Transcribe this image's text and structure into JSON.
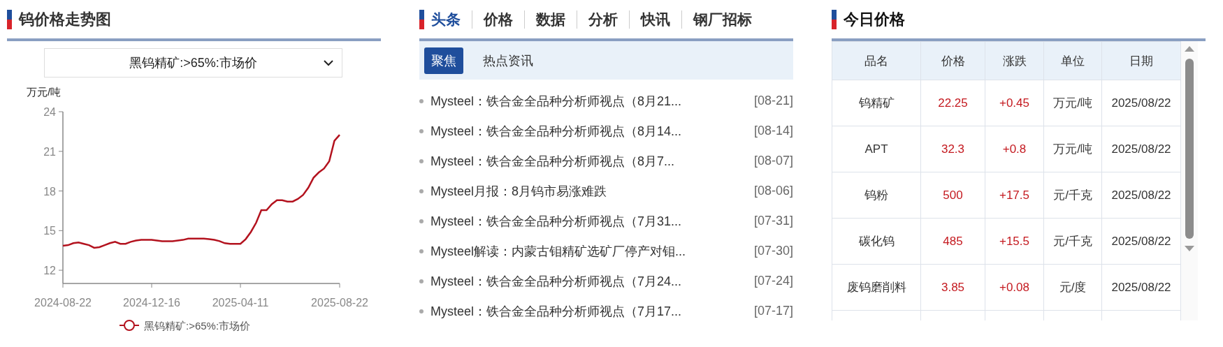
{
  "chart_panel": {
    "title": "钨价格走势图",
    "select": {
      "value": "黑钨精矿:>65%:市场价"
    },
    "chart_data": {
      "type": "line",
      "ylabel": "万元/吨",
      "categories": [
        "2024-08-22",
        null,
        null,
        null,
        null,
        null,
        null,
        null,
        null,
        null,
        null,
        null,
        null,
        null,
        null,
        null,
        null,
        "2024-12-16",
        null,
        null,
        null,
        null,
        null,
        null,
        null,
        null,
        null,
        null,
        null,
        null,
        null,
        null,
        null,
        null,
        "2025-04-11",
        null,
        null,
        null,
        null,
        null,
        null,
        null,
        null,
        null,
        null,
        null,
        null,
        null,
        null,
        null,
        null,
        null,
        null,
        "2025-08-22"
      ],
      "ylim": [
        11,
        24
      ],
      "yticks": [
        12,
        15,
        18,
        21,
        24
      ],
      "series": [
        {
          "name": "黑钨精矿:>65%:市场价",
          "color": "#b3121e",
          "values": [
            13.85,
            13.9,
            14.05,
            14.1,
            14.0,
            13.9,
            13.7,
            13.75,
            13.9,
            14.05,
            14.15,
            14.0,
            14.0,
            14.15,
            14.25,
            14.3,
            14.3,
            14.3,
            14.25,
            14.2,
            14.2,
            14.2,
            14.25,
            14.3,
            14.4,
            14.4,
            14.4,
            14.4,
            14.35,
            14.3,
            14.2,
            14.05,
            14.0,
            14.0,
            14.0,
            14.35,
            14.9,
            15.6,
            16.55,
            16.55,
            17.0,
            17.3,
            17.3,
            17.2,
            17.2,
            17.4,
            17.7,
            18.25,
            19.0,
            19.4,
            19.7,
            20.25,
            21.8,
            22.25
          ]
        }
      ]
    }
  },
  "news_panel": {
    "tabs": [
      {
        "label": "头条",
        "selected": true
      },
      {
        "label": "价格",
        "selected": false
      },
      {
        "label": "数据",
        "selected": false
      },
      {
        "label": "分析",
        "selected": false
      },
      {
        "label": "快讯",
        "selected": false
      },
      {
        "label": "钢厂招标",
        "selected": false
      }
    ],
    "subtabs": [
      {
        "label": "聚焦",
        "selected": true
      },
      {
        "label": "热点资讯",
        "selected": false
      }
    ],
    "items": [
      {
        "title": "Mysteel：铁合金全品种分析师视点（8月21...",
        "date": "[08-21]"
      },
      {
        "title": "Mysteel：铁合金全品种分析师视点（8月14...",
        "date": "[08-14]"
      },
      {
        "title": "Mysteel：铁合金全品种分析师视点（8月7...",
        "date": "[08-07]"
      },
      {
        "title": "Mysteel月报：8月钨市易涨难跌",
        "date": "[08-06]"
      },
      {
        "title": "Mysteel：铁合金全品种分析师视点（7月31...",
        "date": "[07-31]"
      },
      {
        "title": "Mysteel解读：内蒙古钼精矿选矿厂停产对钼...",
        "date": "[07-30]"
      },
      {
        "title": "Mysteel：铁合金全品种分析师视点（7月24...",
        "date": "[07-24]"
      },
      {
        "title": "Mysteel：铁合金全品种分析师视点（7月17...",
        "date": "[07-17]"
      }
    ]
  },
  "price_panel": {
    "title": "今日价格",
    "columns": [
      "品名",
      "价格",
      "涨跌",
      "单位",
      "日期"
    ],
    "rows": [
      [
        "钨精矿",
        "22.25",
        "+0.45",
        "万元/吨",
        "2025/08/22"
      ],
      [
        "APT",
        "32.3",
        "+0.8",
        "万元/吨",
        "2025/08/22"
      ],
      [
        "钨粉",
        "500",
        "+17.5",
        "元/千克",
        "2025/08/22"
      ],
      [
        "碳化钨",
        "485",
        "+15.5",
        "元/千克",
        "2025/08/22"
      ],
      [
        "废钨磨削料",
        "3.85",
        "+0.08",
        "元/度",
        "2025/08/22"
      ]
    ]
  }
}
